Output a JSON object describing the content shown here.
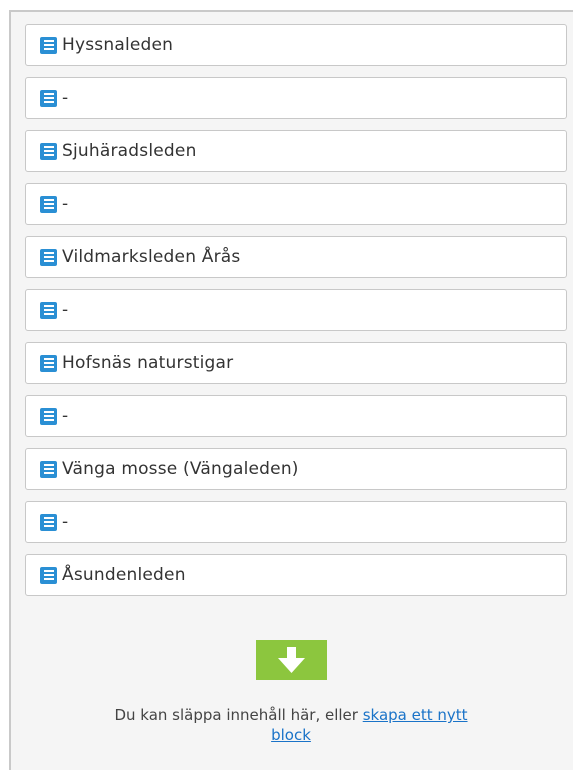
{
  "content_area": {
    "blocks": [
      {
        "label": "Hyssnaleden",
        "icon": "block-icon"
      },
      {
        "label": "-",
        "icon": "block-icon"
      },
      {
        "label": "Sjuhäradsleden",
        "icon": "block-icon"
      },
      {
        "label": "-",
        "icon": "block-icon"
      },
      {
        "label": "Vildmarksleden Årås",
        "icon": "block-icon"
      },
      {
        "label": "-",
        "icon": "block-icon"
      },
      {
        "label": "Hofsnäs naturstigar",
        "icon": "block-icon"
      },
      {
        "label": "-",
        "icon": "block-icon"
      },
      {
        "label": "Vänga mosse (Vängaleden)",
        "icon": "block-icon"
      },
      {
        "label": "-",
        "icon": "block-icon"
      },
      {
        "label": "Åsundenleden",
        "icon": "block-icon"
      }
    ],
    "drop_zone": {
      "text": "Du kan släppa innehåll här, eller",
      "link_label": "skapa ett nytt block",
      "icon": "arrow-down-icon"
    }
  },
  "colors": {
    "block_icon": "#2a8fd4",
    "drop_arrow": "#8cc63e",
    "link": "#1a73c8"
  }
}
